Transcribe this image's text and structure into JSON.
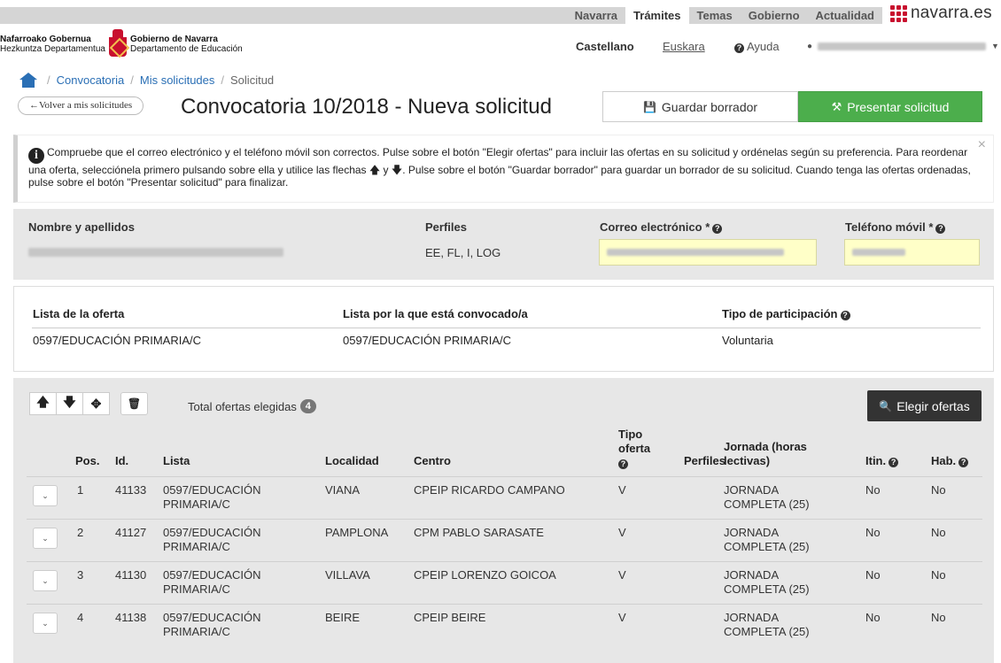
{
  "top_nav": {
    "items": [
      "Navarra",
      "Trámites",
      "Temas",
      "Gobierno",
      "Actualidad"
    ],
    "active": "Trámites",
    "brand": "navarra.es",
    "brand_color": "#c8102e"
  },
  "header": {
    "org_line1": "Nafarroako Gobernua",
    "org_line2": "Hezkuntza Departamentua",
    "org_line3": "Gobierno de Navarra",
    "org_line4": "Departamento de Educación",
    "lang_active": "Castellano",
    "lang_other": "Euskara",
    "help": "Ayuda",
    "help_icon": "question-circle-icon",
    "user_icon": "user-icon"
  },
  "breadcrumb": {
    "home_icon": "home-icon",
    "items": [
      "Convocatoria",
      "Mis solicitudes",
      "Solicitud"
    ]
  },
  "page": {
    "back_label": "←Volver a mis solicitudes",
    "title": "Convocatoria 10/2018 - Nueva solicitud",
    "save_label": "Guardar borrador",
    "save_icon": "floppy-disk-icon",
    "submit_label": "Presentar solicitud",
    "submit_icon": "gavel-icon",
    "accent_green": "#4cae4c"
  },
  "info": {
    "icon": "info-icon",
    "text": "Compruebe que el correo electrónico y el teléfono móvil son correctos. Pulse sobre el botón \"Elegir ofertas\" para incluir las ofertas en su solicitud y ordénelas según su preferencia. Para reordenar una oferta, selecciónela primero pulsando sobre ella y utilice las flechas 🡅 y 🡇. Pulse sobre el botón \"Guardar borrador\" para guardar un borrador de su solicitud. Cuando tenga las ofertas ordenadas, pulse sobre el botón \"Presentar solicitud\" para finalizar.",
    "close": "×"
  },
  "profile": {
    "name_label": "Nombre y apellidos",
    "profiles_label": "Perfiles",
    "profiles_value": "EE, FL, I, LOG",
    "email_label": "Correo electrónico *",
    "phone_label": "Teléfono móvil *"
  },
  "convocation": {
    "headers": [
      "Lista de la oferta",
      "Lista por la que está convocado/a",
      "Tipo de participación"
    ],
    "values": [
      "0597/EDUCACIÓN PRIMARIA/C",
      "0597/EDUCACIÓN PRIMARIA/C",
      "Voluntaria"
    ]
  },
  "offers": {
    "toolbar": {
      "up": "🡅",
      "down": "🡇",
      "move": "✥",
      "delete": "🗑"
    },
    "total_label": "Total ofertas elegidas",
    "total_count": "4",
    "choose_label": "Elegir ofertas",
    "choose_icon": "search-plus-icon",
    "columns": [
      "Pos.",
      "Id.",
      "Lista",
      "Localidad",
      "Centro",
      "Tipo oferta",
      "Perfiles",
      "Jornada (horas lectivas)",
      "Itin.",
      "Hab."
    ],
    "rows": [
      {
        "pos": "1",
        "id": "41133",
        "lista_1": "0597/EDUCACIÓN",
        "lista_2": "PRIMARIA/C",
        "localidad": "VIANA",
        "centro": "CPEIP RICARDO CAMPANO",
        "tipo": "V",
        "perfiles": "",
        "jornada_1": "JORNADA",
        "jornada_2": "COMPLETA (25)",
        "itin": "No",
        "hab": "No"
      },
      {
        "pos": "2",
        "id": "41127",
        "lista_1": "0597/EDUCACIÓN",
        "lista_2": "PRIMARIA/C",
        "localidad": "PAMPLONA",
        "centro": "CPM PABLO SARASATE",
        "tipo": "V",
        "perfiles": "",
        "jornada_1": "JORNADA",
        "jornada_2": "COMPLETA (25)",
        "itin": "No",
        "hab": "No"
      },
      {
        "pos": "3",
        "id": "41130",
        "lista_1": "0597/EDUCACIÓN",
        "lista_2": "PRIMARIA/C",
        "localidad": "VILLAVA",
        "centro": "CPEIP LORENZO GOICOA",
        "tipo": "V",
        "perfiles": "",
        "jornada_1": "JORNADA",
        "jornada_2": "COMPLETA (25)",
        "itin": "No",
        "hab": "No"
      },
      {
        "pos": "4",
        "id": "41138",
        "lista_1": "0597/EDUCACIÓN",
        "lista_2": "PRIMARIA/C",
        "localidad": "BEIRE",
        "centro": "CPEIP BEIRE",
        "tipo": "V",
        "perfiles": "",
        "jornada_1": "JORNADA",
        "jornada_2": "COMPLETA (25)",
        "itin": "No",
        "hab": "No"
      }
    ]
  }
}
